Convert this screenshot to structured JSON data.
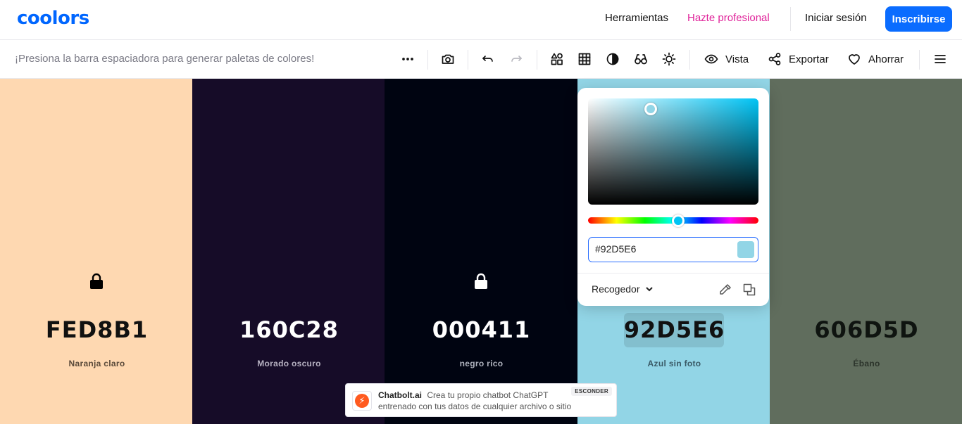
{
  "header": {
    "logo": "coolors",
    "nav": {
      "tools": "Herramientas",
      "pro": "Hazte profesional",
      "signin": "Iniciar sesión",
      "signup": "Inscribirse"
    }
  },
  "toolbar": {
    "hint": "¡Presiona la barra espaciadora para generar paletas de colores!",
    "view_label": "Vista",
    "export_label": "Exportar",
    "save_label": "Ahorrar",
    "icons": [
      "more-icon",
      "camera-icon",
      "undo-icon",
      "redo-icon",
      "shapes-icon",
      "grid-icon",
      "contrast-icon",
      "glasses-icon",
      "brightness-icon",
      "eye-icon",
      "share-icon",
      "heart-icon",
      "menu-icon"
    ]
  },
  "palette": [
    {
      "hex": "FED8B1",
      "name": "Naranja claro",
      "bg": "#FED8B1",
      "text": "#111111",
      "sub": "#5a4a3a",
      "locked": true,
      "lock_color": "#000000"
    },
    {
      "hex": "160C28",
      "name": "Morado oscuro",
      "bg": "#160C28",
      "text": "#ffffff",
      "sub": "#b7b2c2",
      "locked": false
    },
    {
      "hex": "000411",
      "name": "negro rico",
      "bg": "#000411",
      "text": "#ffffff",
      "sub": "#aeb2bd",
      "locked": true,
      "lock_color": "#ffffff"
    },
    {
      "hex": "92D5E6",
      "name": "Azul sin foto",
      "bg": "#92D5E6",
      "text": "#111111",
      "sub": "#3a5a66",
      "locked": false,
      "selected": true
    },
    {
      "hex": "606D5D",
      "name": "Ébano",
      "bg": "#606D5D",
      "text": "#0f1410",
      "sub": "#2c342b",
      "locked": false
    }
  ],
  "picker": {
    "hex_value": "#92D5E6",
    "swatch_color": "#92D5E6",
    "mode_label": "Recogedor"
  },
  "ad": {
    "brand": "Chatbolt.ai",
    "line1": "Crea tu propio chatbot ChatGPT",
    "line2": "entrenado con tus datos de cualquier archivo o sitio",
    "hide_label": "ESCONDER"
  }
}
